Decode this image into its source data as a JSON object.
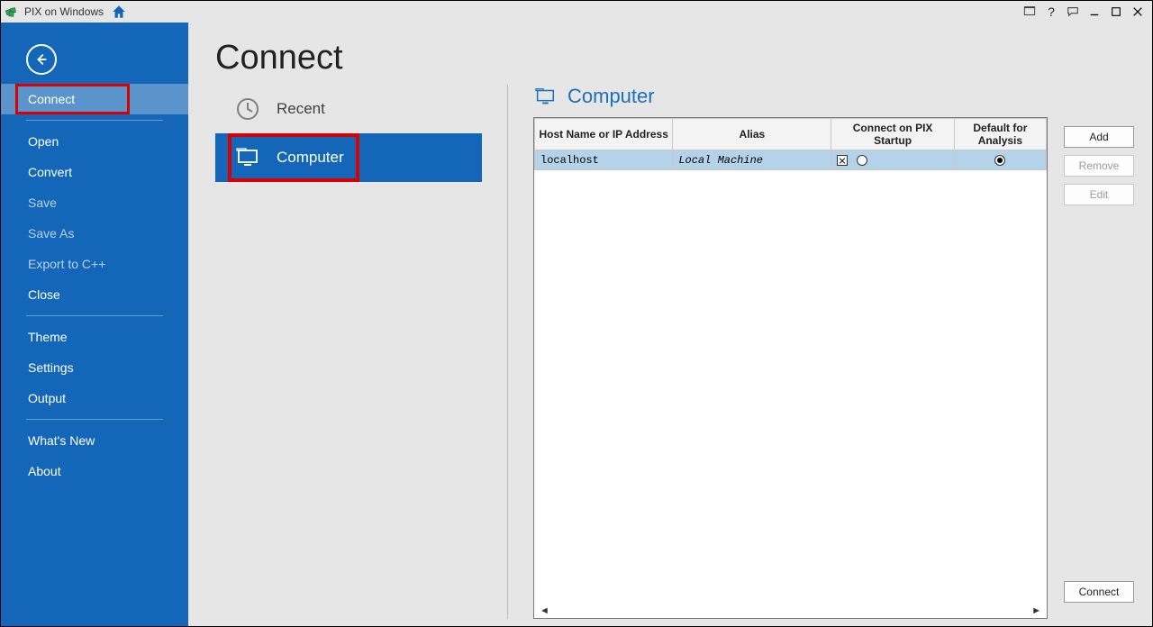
{
  "titlebar": {
    "app_title": "PIX on Windows"
  },
  "sidebar": {
    "items": [
      {
        "label": "Connect",
        "selected": true,
        "highlighted": true,
        "bright": true
      },
      {
        "label": "Open",
        "bright": true
      },
      {
        "label": "Convert",
        "bright": true
      },
      {
        "label": "Save",
        "dim": true
      },
      {
        "label": "Save As",
        "dim": true
      },
      {
        "label": "Export to C++",
        "dim": true
      },
      {
        "label": "Close",
        "bright": true
      },
      {
        "label": "Theme",
        "bright": true
      },
      {
        "label": "Settings",
        "bright": true
      },
      {
        "label": "Output",
        "bright": true
      },
      {
        "label": "What's New",
        "bright": true
      },
      {
        "label": "About",
        "bright": true
      }
    ]
  },
  "page": {
    "title": "Connect",
    "options": {
      "recent": "Recent",
      "computer": "Computer"
    },
    "panel": {
      "title": "Computer",
      "columns": {
        "host": "Host Name or IP Address",
        "alias": "Alias",
        "connect": "Connect on PIX Startup",
        "default": "Default for Analysis"
      },
      "rows": [
        {
          "host": "localhost",
          "alias": "Local Machine",
          "connect_checked": true,
          "default_selected": true
        }
      ],
      "buttons": {
        "add": "Add",
        "remove": "Remove",
        "edit": "Edit",
        "connect": "Connect"
      }
    }
  }
}
